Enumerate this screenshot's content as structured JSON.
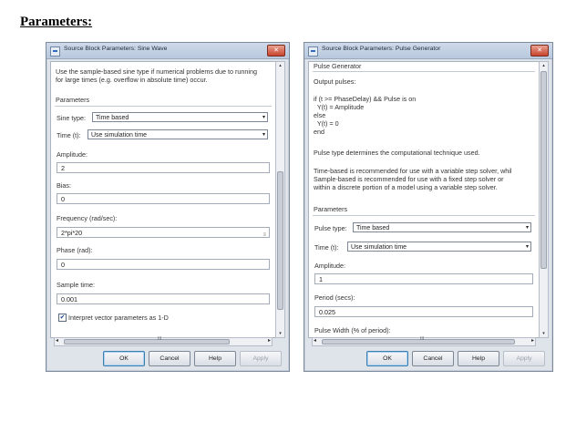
{
  "page": {
    "heading": "Parameters:"
  },
  "sine_dialog": {
    "title": "Source Block Parameters: Sine Wave",
    "description_lines": [
      "Use the sample-based sine type if numerical problems due to running",
      "for large times (e.g. overflow in absolute time) occur."
    ],
    "section_label": "Parameters",
    "sine_type": {
      "label": "Sine type:",
      "value": "Time based"
    },
    "time": {
      "label": "Time (t):",
      "value": "Use simulation time"
    },
    "amplitude": {
      "label": "Amplitude:",
      "value": "2"
    },
    "bias": {
      "label": "Bias:",
      "value": "0"
    },
    "frequency": {
      "label": "Frequency (rad/sec):",
      "value": "2*pi*20"
    },
    "phase": {
      "label": "Phase (rad):",
      "value": "0"
    },
    "sample_time": {
      "label": "Sample time:",
      "value": "0.001"
    },
    "interpret_checkbox": {
      "label": "Interpret vector parameters as 1-D",
      "checked": true,
      "mark": "✔"
    },
    "buttons": {
      "ok": "OK",
      "cancel": "Cancel",
      "help": "Help",
      "apply": "Apply"
    },
    "icons": {
      "close": "close-icon",
      "scroll_left": "◂",
      "scroll_right": "▸",
      "scroll_up": "▴",
      "scroll_down": "▾",
      "hscroll_grip": "III",
      "field_grip": "≡"
    }
  },
  "pulse_dialog": {
    "title": "Source Block Parameters: Pulse Generator",
    "block_name": "Pulse Generator",
    "output_label": "Output pulses:",
    "code_lines": [
      "if (t >= PhaseDelay) && Pulse is on",
      "  Y(t) = Amplitude",
      "else",
      "  Y(t) = 0",
      "end"
    ],
    "pulse_type_desc": "Pulse type determines the computational technique used.",
    "desc_lines": [
      "Time-based is recommended for use with a variable step solver, whil",
      "Sample-based is recommended for use with a fixed step solver or",
      "within a discrete portion of a model using a variable step solver."
    ],
    "section_label": "Parameters",
    "pulse_type": {
      "label": "Pulse type:",
      "value": "Time based"
    },
    "time": {
      "label": "Time (t):",
      "value": "Use simulation time"
    },
    "amplitude": {
      "label": "Amplitude:",
      "value": "1"
    },
    "period": {
      "label": "Period (secs):",
      "value": "0.025"
    },
    "pulse_width_label": "Pulse Width (% of period):",
    "buttons": {
      "ok": "OK",
      "cancel": "Cancel",
      "help": "Help",
      "apply": "Apply"
    },
    "icons": {
      "close": "close-icon",
      "scroll_left": "◂",
      "scroll_right": "▸",
      "scroll_up": "▴",
      "scroll_down": "▾",
      "hscroll_grip": "III"
    }
  },
  "colors": {
    "titlebar": "#c3d1e4",
    "close_button": "#c8452e",
    "dialog_bg": "#dfe3ea"
  }
}
